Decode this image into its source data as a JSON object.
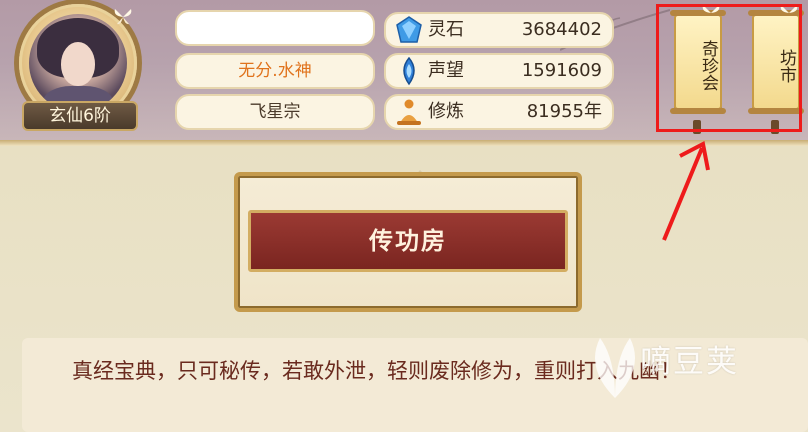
{
  "player": {
    "rank": "玄仙6阶",
    "name": "",
    "title": "无分.水神",
    "sect": "飞星宗"
  },
  "stats": [
    {
      "icon": "spirit-stone-icon",
      "label": "灵石",
      "value": "3684402"
    },
    {
      "icon": "reputation-icon",
      "label": "声望",
      "value": "1591609"
    },
    {
      "icon": "cultivation-icon",
      "label": "修炼",
      "value": "81955年"
    }
  ],
  "buttons": {
    "qizhen": "奇珍会",
    "fangshi": "坊市"
  },
  "banner": {
    "title": "传功房"
  },
  "message": {
    "text": "真经宝典，只可秘传，若敢外泄，轻则废除修为，重则打入九幽！"
  },
  "watermark": {
    "text": "嘀豆荚"
  },
  "colors": {
    "highlight": "#ee1b1b",
    "title_orange": "#e0731d",
    "banner_red": "#8a2e28"
  }
}
